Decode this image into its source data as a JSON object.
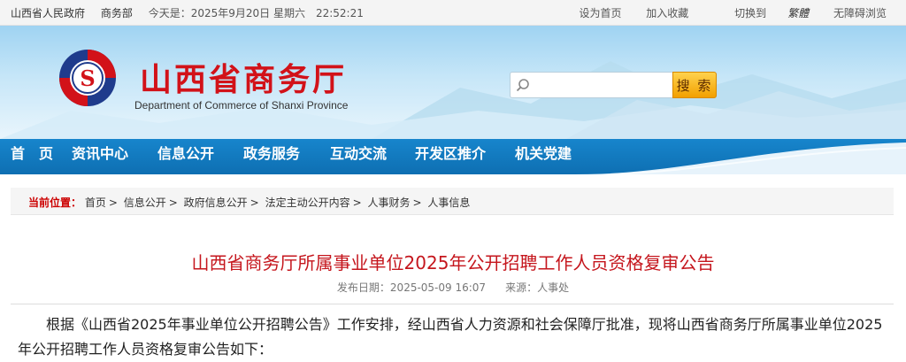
{
  "topbar": {
    "gov_link": "山西省人民政府",
    "dept_link": "商务部",
    "date_text": "今天是：2025年9月20日 星期六　22:52:21",
    "set_home": "设为首页",
    "add_fav": "加入收藏",
    "switch_label": "切换到",
    "switch_target": "繁體",
    "accessibility": "无障碍浏览"
  },
  "header": {
    "title": "山西省商务厅",
    "subtitle": "Department of Commerce of Shanxi Province",
    "search_placeholder": "",
    "search_button": "搜 索",
    "logo_letter": "S"
  },
  "nav": {
    "items": [
      {
        "label": "首　页"
      },
      {
        "label": "资讯中心"
      },
      {
        "label": "信息公开"
      },
      {
        "label": "政务服务"
      },
      {
        "label": "互动交流"
      },
      {
        "label": "开发区推介"
      },
      {
        "label": "机关党建"
      }
    ]
  },
  "breadcrumb": {
    "label": "当前位置：",
    "items": [
      "首页",
      "信息公开",
      "政府信息公开",
      "法定主动公开内容",
      "人事财务",
      "人事信息"
    ]
  },
  "article": {
    "title": "山西省商务厅所属事业单位2025年公开招聘工作人员资格复审公告",
    "date_label": "发布日期：",
    "date": "2025-05-09 16:07",
    "source_label": "来源：",
    "source": "人事处",
    "body": "根据《山西省2025年事业单位公开招聘公告》工作安排，经山西省人力资源和社会保障厅批准，现将山西省商务厅所属事业单位2025年公开招聘工作人员资格复审公告如下："
  },
  "colors": {
    "brand_red": "#d21219",
    "nav_blue": "#1785cc",
    "search_orange": "#f2a000"
  }
}
